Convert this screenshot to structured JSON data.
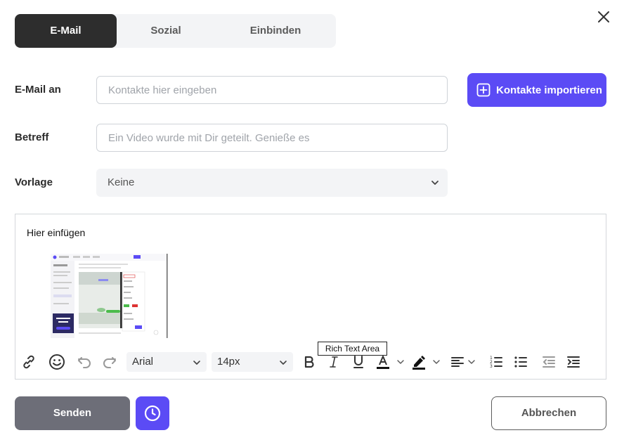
{
  "tabs": [
    {
      "label": "E-Mail",
      "active": true
    },
    {
      "label": "Sozial",
      "active": false
    },
    {
      "label": "Einbinden",
      "active": false
    }
  ],
  "form": {
    "email_to_label": "E-Mail an",
    "email_to_placeholder": "Kontakte hier eingeben",
    "subject_label": "Betreff",
    "subject_placeholder": "Ein Video wurde mit Dir geteilt. Genieße es",
    "template_label": "Vorlage",
    "template_value": "Keine",
    "import_button": "Kontakte importieren"
  },
  "editor": {
    "body_text": "Hier einfügen",
    "tooltip": "Rich Text Area",
    "font_family": "Arial",
    "font_size": "14px"
  },
  "footer": {
    "send_label": "Senden",
    "cancel_label": "Abbrechen"
  },
  "colors": {
    "accent": "#5b4bf5",
    "dark_tab": "#2d2d2d",
    "send_gray": "#6d6e78"
  },
  "icons": {
    "close": "close-icon",
    "import": "plus-square-icon",
    "link": "link-icon",
    "emoji": "emoji-icon",
    "undo": "undo-icon",
    "redo": "redo-icon",
    "bold": "bold-icon",
    "italic": "italic-icon",
    "underline": "underline-icon",
    "text_color": "text-color-icon",
    "highlight": "highlight-icon",
    "align": "align-left-icon",
    "ordered_list": "ordered-list-icon",
    "bullet_list": "bullet-list-icon",
    "outdent": "outdent-icon",
    "indent": "indent-icon",
    "schedule": "clock-icon"
  }
}
